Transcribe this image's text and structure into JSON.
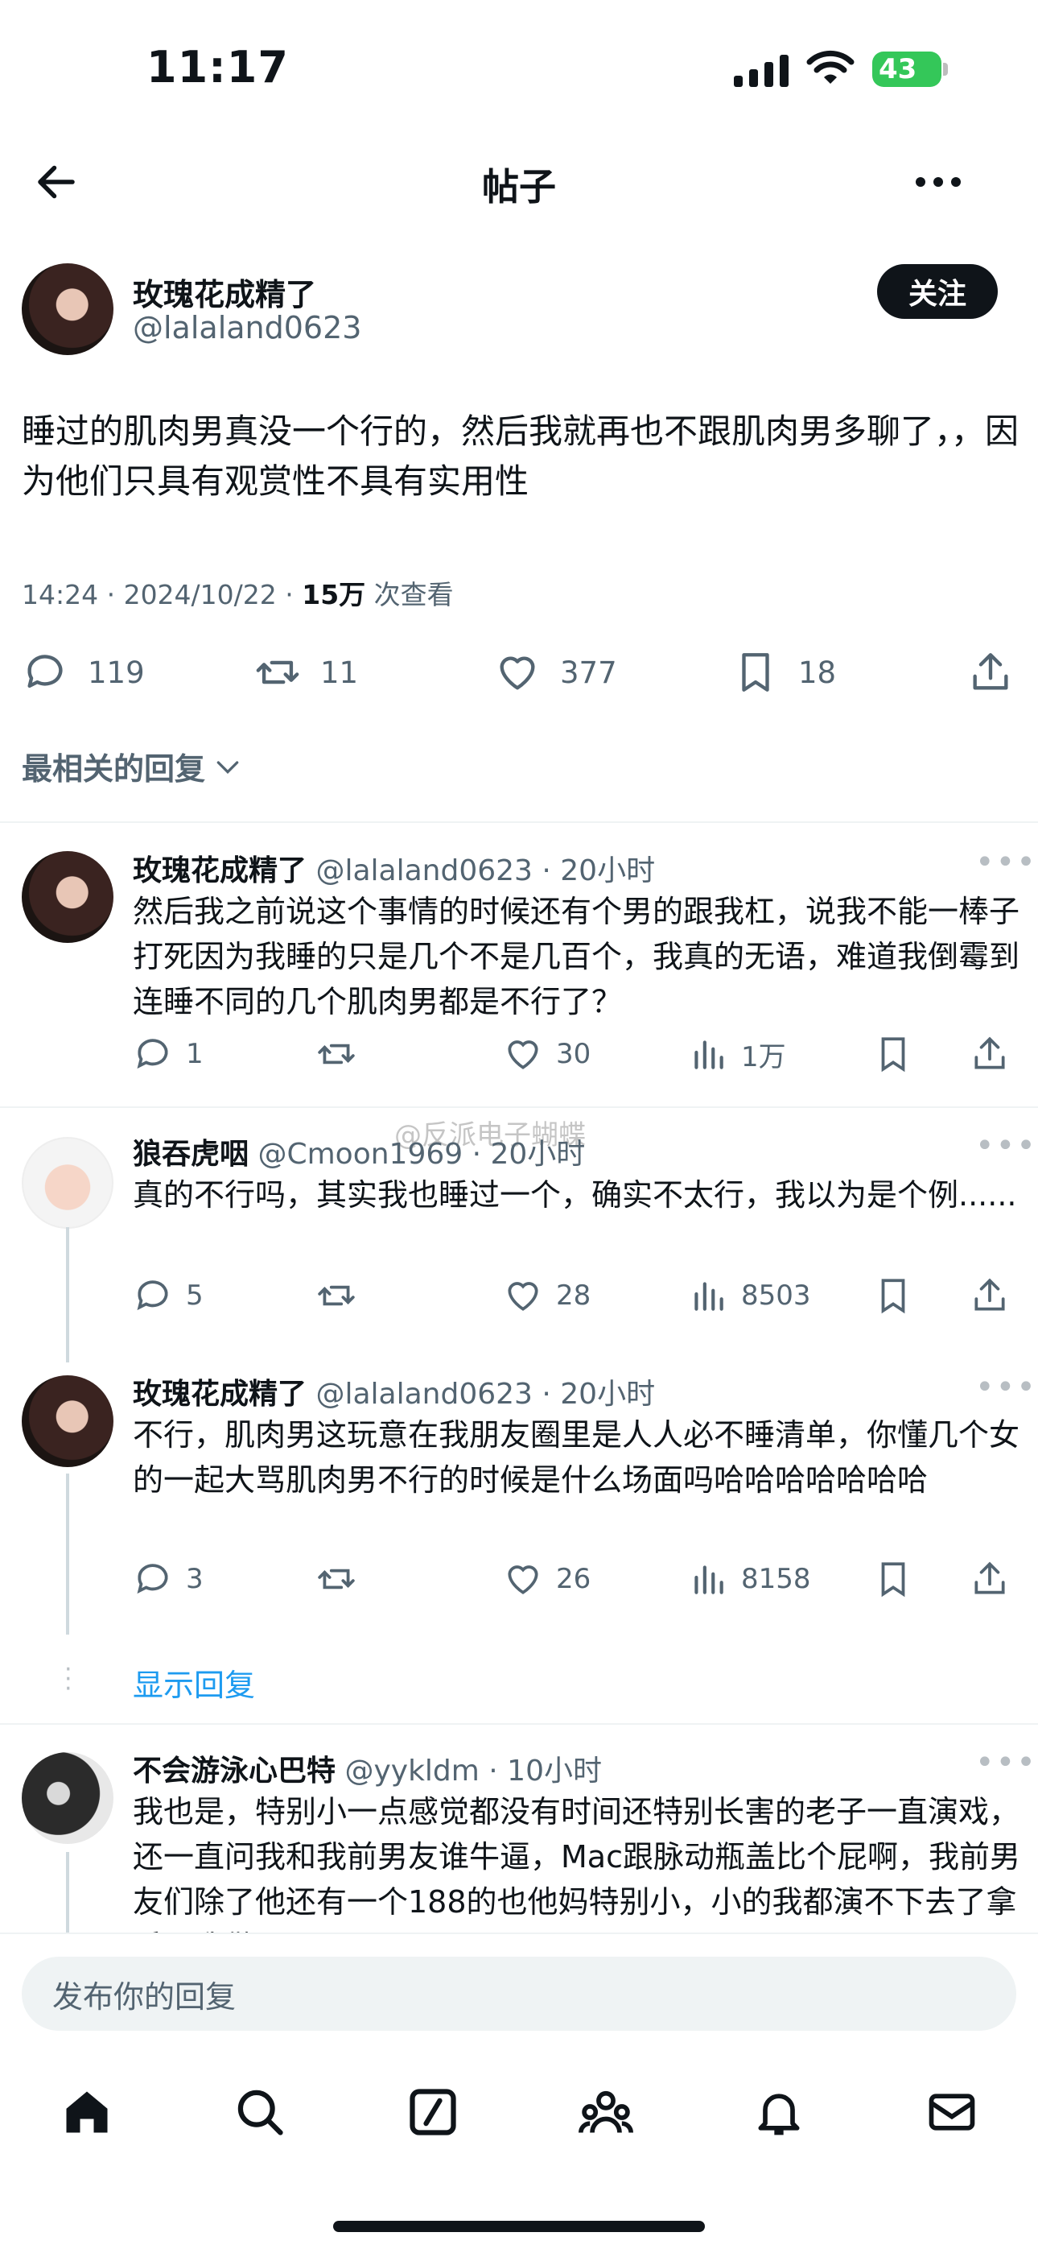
{
  "status": {
    "time": "11:17",
    "battery": "43"
  },
  "header": {
    "title": "帖子",
    "back_icon": "arrow-left-icon",
    "more_icon": "more-icon"
  },
  "post": {
    "name": "玫瑰花成精了",
    "handle": "@lalaland0623",
    "follow_label": "关注",
    "text": "睡过的肌肉男真没一个行的，然后我就再也不跟肌肉男多聊了，，因为他们只具有观赏性不具有实用性",
    "time": "14:24 · 2024/10/22 · ",
    "views": "15万",
    "views_label": " 次查看",
    "stats": {
      "replies": "119",
      "retweets": "11",
      "likes": "377",
      "bookmarks": "18"
    }
  },
  "sort": {
    "label": "最相关的回复"
  },
  "replies": [
    {
      "name": "玫瑰花成精了",
      "handle": "@lalaland0623 · 20小时",
      "text": "然后我之前说这个事情的时候还有个男的跟我杠，说我不能一棒子打死因为我睡的只是几个不是几百个，我真的无语，难道我倒霉到连睡不同的几个肌肉男都是不行了？",
      "replies": "1",
      "likes": "30",
      "views": "1万"
    },
    {
      "name": "狼吞虎咽",
      "handle": "@Cmoon1969 · 20小时",
      "text": "真的不行吗，其实我也睡过一个，确实不太行，我以为是个例......",
      "replies": "5",
      "likes": "28",
      "views": "8503"
    },
    {
      "name": "玫瑰花成精了",
      "handle": "@lalaland0623 · 20小时",
      "text": "不行，肌肉男这玩意在我朋友圈里是人人必不睡清单，你懂几个女的一起大骂肌肉男不行的时候是什么场面吗哈哈哈哈哈哈哈",
      "replies": "3",
      "likes": "26",
      "views": "8158"
    },
    {
      "name": "不会游泳心巴特",
      "handle": "@yykldm · 10小时",
      "text": "我也是，特别小一点感觉都没有时间还特别长害的老子一直演戏，还一直问我和我前男友谁牛逼，Mac跟脉动瓶盖比个屁啊，我前男友们除了他还有一个188的也他妈特别小，小的我都演不下去了拿手跟我做"
    }
  ],
  "show_replies": "显示回复",
  "watermark": "@反派电子蝴蝶",
  "reply_box": {
    "placeholder": "发布你的回复"
  },
  "tabs": [
    "home-icon",
    "search-icon",
    "compose-icon",
    "communities-icon",
    "notifications-icon",
    "messages-icon"
  ]
}
